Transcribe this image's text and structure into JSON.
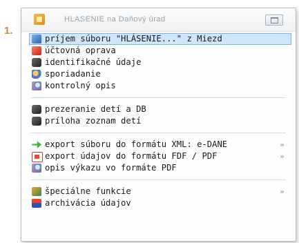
{
  "step_number": "1.",
  "window": {
    "title": "HLASENIE na Daňový úrad"
  },
  "menu": {
    "group1": [
      {
        "label": "príjem súboru \"HLÁSENIE...\" z Miezd",
        "icon": "import-icon",
        "selected": true
      },
      {
        "label": "účtovná oprava",
        "icon": "correction-icon"
      },
      {
        "label": "identifikačné údaje",
        "icon": "id-card-icon"
      },
      {
        "label": "sporiadanie",
        "icon": "people-icon"
      },
      {
        "label": "kontrolný opis",
        "icon": "inspect-icon"
      }
    ],
    "group2": [
      {
        "label": "prezeranie detí a DB",
        "icon": "children-view-icon"
      },
      {
        "label": "príloha zoznam detí",
        "icon": "attachment-icon"
      }
    ],
    "group3": [
      {
        "label": "export súboru do formátu XML: e-DANE",
        "icon": "export-arrow-icon",
        "submenu": true
      },
      {
        "label": "export údajov do formátu FDF / PDF",
        "icon": "pdf-icon",
        "submenu": true
      },
      {
        "label": "opis výkazu vo formáte PDF",
        "icon": "report-icon"
      }
    ],
    "group4": [
      {
        "label": "špeciálne funkcie",
        "icon": "tools-icon",
        "submenu": true
      },
      {
        "label": "archivácia údajov",
        "icon": "archive-icon"
      }
    ]
  }
}
